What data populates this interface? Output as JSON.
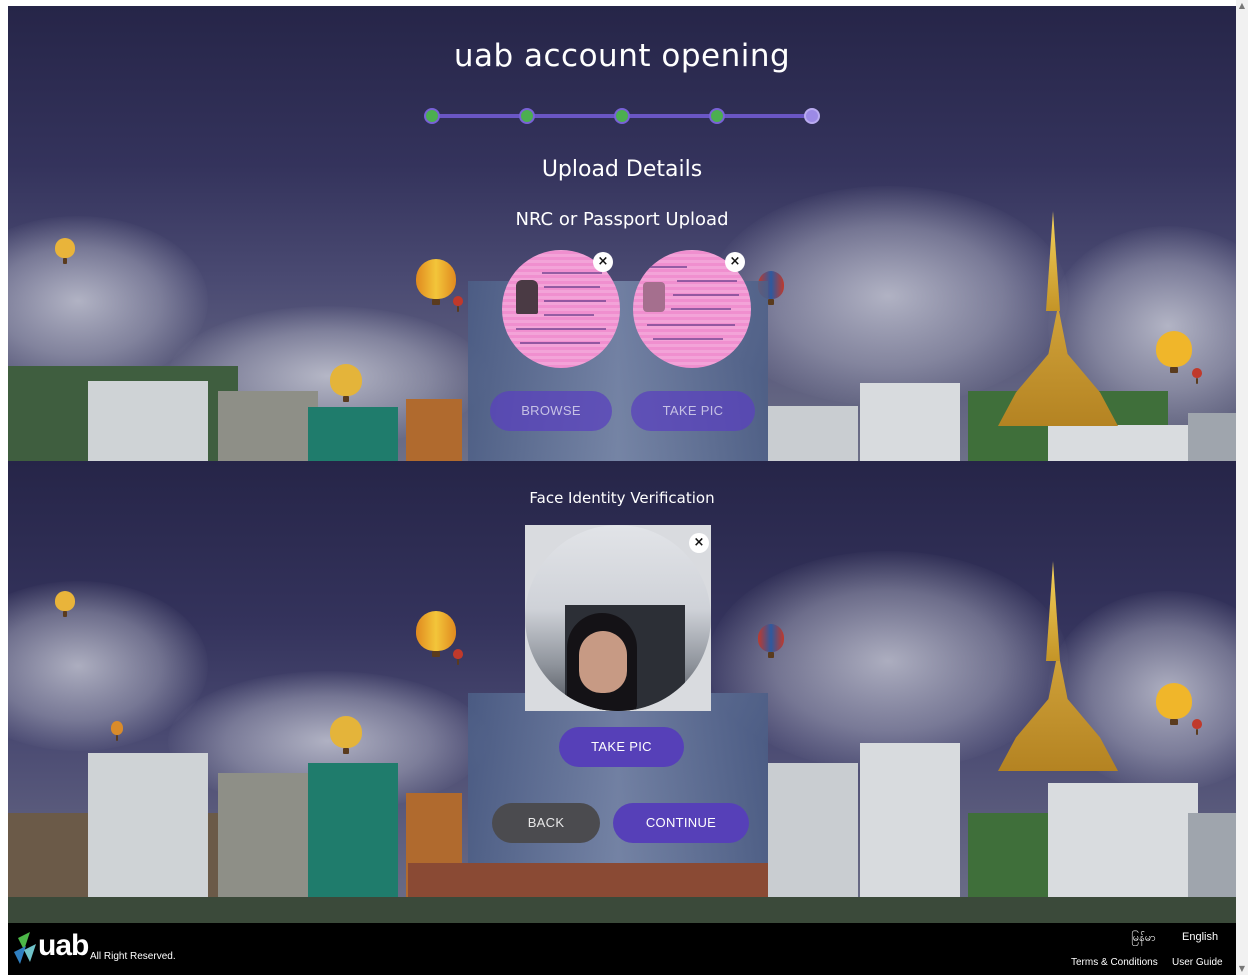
{
  "header": {
    "title": "uab account opening",
    "steps": [
      {
        "status": "complete"
      },
      {
        "status": "complete"
      },
      {
        "status": "complete"
      },
      {
        "status": "complete"
      },
      {
        "status": "current"
      }
    ]
  },
  "upload": {
    "heading": "Upload Details",
    "subheading": "NRC or Passport Upload",
    "remove_glyph": "×",
    "browse_label": "BROWSE",
    "take_pic_label": "TAKE PIC"
  },
  "face": {
    "heading": "Face Identity Verification",
    "remove_glyph": "×",
    "take_pic_label": "TAKE PIC"
  },
  "actions": {
    "back_label": "BACK",
    "continue_label": "CONTINUE"
  },
  "footer": {
    "logo": "uab",
    "copyright": "All Right Reserved.",
    "lang_myanmar": "မြန်မာ",
    "lang_english": "English",
    "terms": "Terms & Conditions",
    "guide": "User Guide"
  },
  "colors": {
    "accent": "#5640b8",
    "step_complete": "#4caf50",
    "step_current": "#9c8ae6",
    "footer_bg": "#000000"
  }
}
